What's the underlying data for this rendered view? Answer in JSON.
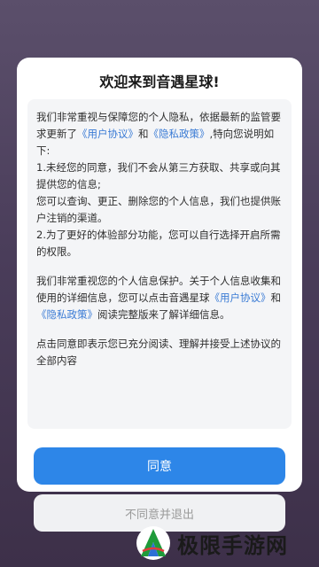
{
  "dialog": {
    "title": "欢迎来到音遇星球!",
    "paragraph1": {
      "intro": "我们非常重视与保障您的个人隐私，依据最新的监管要求更新了",
      "link_user": "《用户协议》",
      "and": "和",
      "link_privacy": "《隐私政策》",
      "after": ",特向您说明如下:",
      "item1": "1.未经您的同意，我们不会从第三方获取、共享或向其提供您的信息;",
      "item1b": "您可以查询、更正、删除您的个人信息，我们也提供账户注销的渠道。",
      "item2": "2.为了更好的体验部分功能，您可以自行选择开启所需的权限。"
    },
    "paragraph2": {
      "intro": "我们非常重视您的个人信息保护。关于个人信息收集和使用的详细信息，您可以点击音遇星球",
      "link_user": "《用户协议》",
      "and": "和",
      "link_privacy": "《隐私政策》",
      "after": "阅读完整版来了解详细信息。"
    },
    "paragraph3": "点击同意即表示您已充分阅读、理解并接受上述协议的全部内容",
    "agree_label": "同意",
    "disagree_label": "不同意并退出"
  },
  "watermark": {
    "text": "极限手游网"
  },
  "colors": {
    "accent": "#2d86e8",
    "link": "#3a7bd5"
  }
}
